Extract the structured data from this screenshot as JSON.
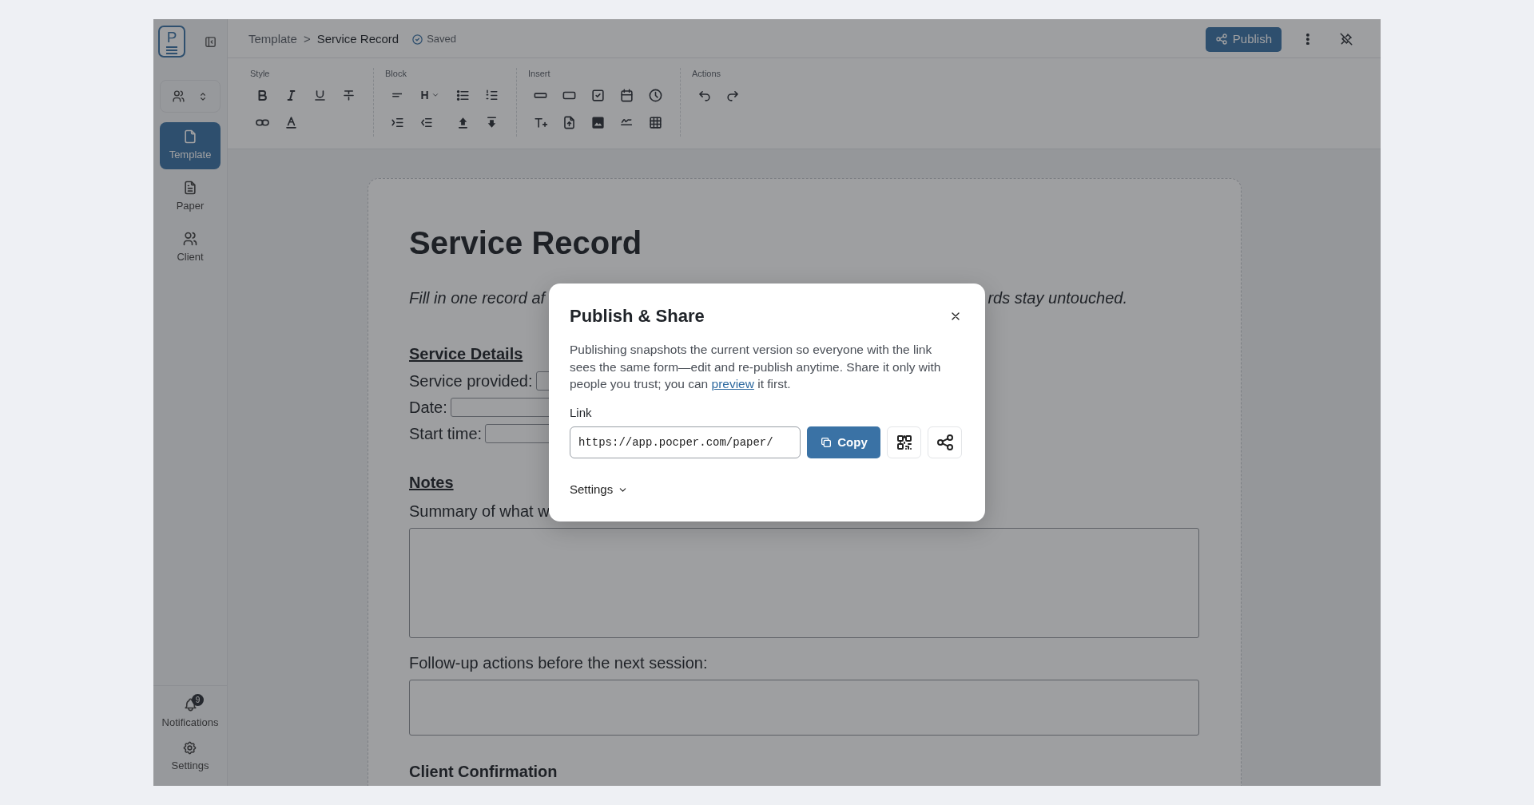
{
  "sidebar": {
    "logo_letter": "P",
    "items": [
      {
        "label": "Template",
        "selected": true
      },
      {
        "label": "Paper",
        "selected": false
      },
      {
        "label": "Client",
        "selected": false
      }
    ],
    "bottom": [
      {
        "label": "Notifications",
        "badge": "9"
      },
      {
        "label": "Settings"
      }
    ]
  },
  "header": {
    "breadcrumb": [
      "Template",
      "Service Record"
    ],
    "separator": ">",
    "status": "Saved",
    "publish_button": "Publish"
  },
  "toolbar": {
    "groups": [
      {
        "label": "Style"
      },
      {
        "label": "Block",
        "heading_text": "H"
      },
      {
        "label": "Insert"
      },
      {
        "label": "Actions"
      }
    ]
  },
  "document": {
    "title": "Service Record",
    "intro_fragments": [
      "Fill in one record af",
      "rds stay untouched."
    ],
    "sections": [
      {
        "heading": "Service Details",
        "underlined": true,
        "fields": [
          {
            "kind": "inline",
            "label": "Service provided:"
          },
          {
            "kind": "inline",
            "label": "Date:"
          },
          {
            "kind": "inline",
            "label": "Start time:"
          }
        ]
      },
      {
        "heading": "Notes",
        "underlined": true,
        "fields": [
          {
            "kind": "long_text",
            "label": "Summary of what w"
          },
          {
            "kind": "short_text",
            "label": "Follow-up actions before the next session:"
          }
        ]
      },
      {
        "heading": "Client Confirmation"
      }
    ]
  },
  "dialog": {
    "title": "Publish & Share",
    "description_before": "Publishing snapshots the current version so everyone with the link sees the same form—edit and re-publish anytime. Share it only with people you trust; you can ",
    "link_text": "preview",
    "description_after": " it first.",
    "link_label": "Link",
    "link_value": "https://app.pocper.com/paper/",
    "copy_button": "Copy",
    "settings_label": "Settings"
  }
}
